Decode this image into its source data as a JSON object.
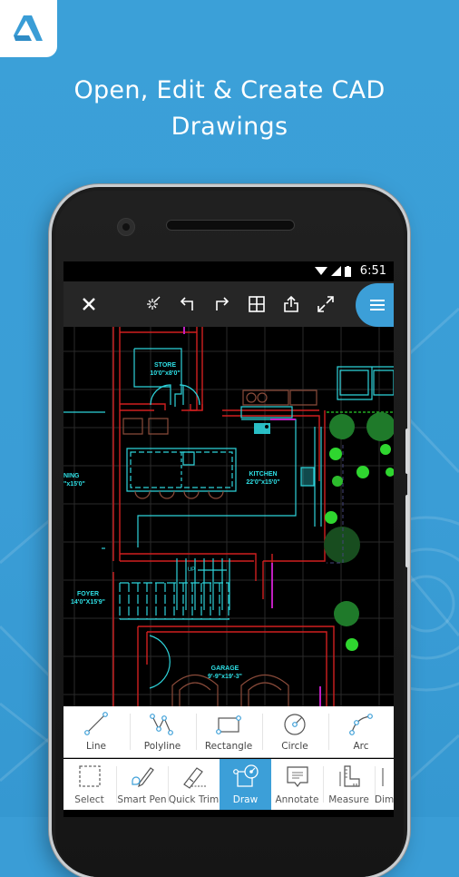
{
  "brand": {
    "logo_icon": "autodesk-a-logo-icon",
    "accent_color": "#3a9dd6"
  },
  "headline": {
    "line1": "Open, Edit & Create CAD",
    "line2": "Drawings"
  },
  "statusbar": {
    "time": "6:51",
    "icons": [
      "wifi-icon",
      "signal-icon",
      "battery-icon"
    ]
  },
  "toolbar": {
    "close_icon": "close-icon",
    "icons": [
      "snap-icon",
      "undo-icon",
      "redo-icon",
      "layers-grid-icon",
      "share-icon",
      "fullscreen-icon"
    ],
    "menu_icon": "hamburger-menu-icon"
  },
  "drawing": {
    "rooms": [
      {
        "name": "STORE",
        "size": "10'0\"x8'0\""
      },
      {
        "name": "KITCHEN",
        "size": "22'0\"x15'0\""
      },
      {
        "name": "NING",
        "size": "\"x15'0\""
      },
      {
        "name": "FOYER",
        "size": "14'0\"X15'9\""
      },
      {
        "name": "GARAGE",
        "size": "9'-9\"x19'-3\""
      }
    ],
    "stair_label": "UP"
  },
  "shapes_panel": {
    "items": [
      {
        "label": "Line",
        "icon": "line-icon"
      },
      {
        "label": "Polyline",
        "icon": "polyline-icon"
      },
      {
        "label": "Rectangle",
        "icon": "rectangle-icon"
      },
      {
        "label": "Circle",
        "icon": "circle-icon"
      },
      {
        "label": "Arc",
        "icon": "arc-icon"
      }
    ]
  },
  "tools_bar": {
    "active": "Draw",
    "items": [
      {
        "label": "Select",
        "icon": "select-icon"
      },
      {
        "label": "Smart Pen",
        "icon": "smart-pen-icon"
      },
      {
        "label": "Quick Trim",
        "icon": "quick-trim-icon"
      },
      {
        "label": "Draw",
        "icon": "draw-icon"
      },
      {
        "label": "Annotate",
        "icon": "annotate-icon"
      },
      {
        "label": "Measure",
        "icon": "measure-icon"
      },
      {
        "label": "Dim",
        "icon": "dimension-icon"
      }
    ]
  }
}
